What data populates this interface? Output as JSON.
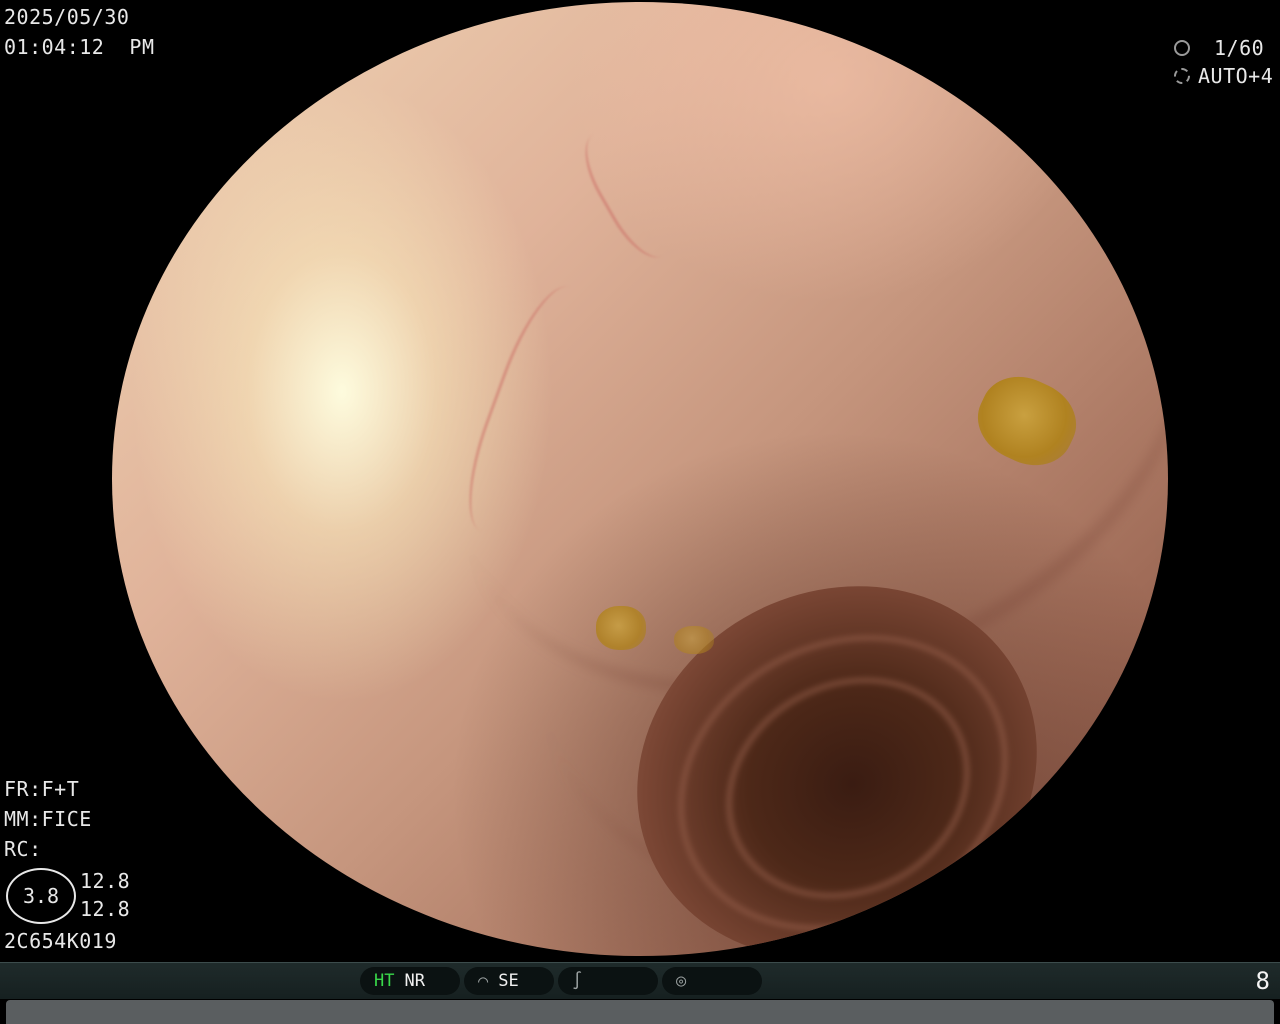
{
  "overlay": {
    "date": "2025/05/30",
    "time": "01:04:12  PM",
    "shutter": "1/60",
    "iris": "AUTO+4",
    "fr": "FR:F+T",
    "mm": "MM:FICE",
    "rc": "RC:",
    "rc_value": "3.8",
    "value_a": "12.8",
    "value_b": "12.8",
    "scope_id": "2C654K019"
  },
  "status_bar": {
    "ht_label": "HT",
    "nr_label": "NR",
    "se_label": "SE",
    "page_number": "8",
    "icons": [
      "structure-enhance-icon",
      "edge-enhance-icon",
      "color-mode-icon"
    ]
  },
  "colors": {
    "ht_active": "#39d84a",
    "overlay_text": "#e8e8e8",
    "status_bar_bg": "#1f2b2b"
  }
}
